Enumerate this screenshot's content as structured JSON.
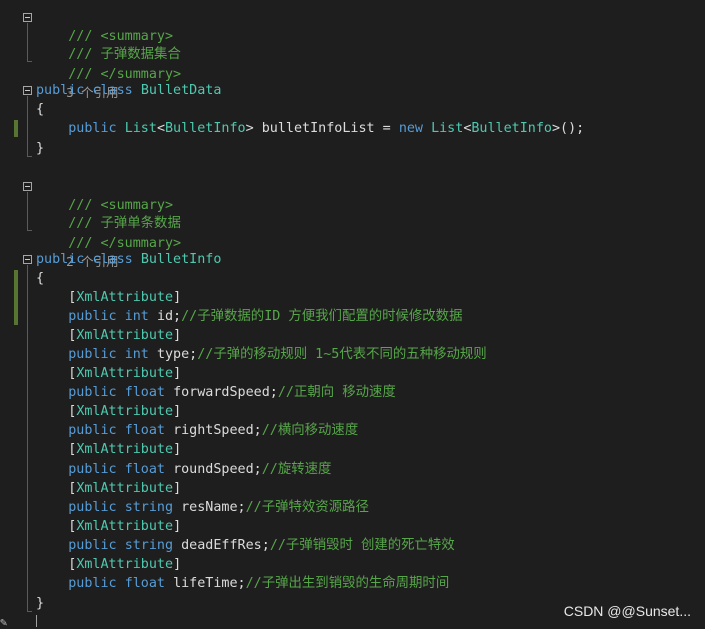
{
  "editor": {
    "block1": {
      "doc_open": "/// <summary>",
      "doc_text": "/// 子弹数据集合",
      "doc_close": "/// </summary>",
      "references": "3 个引用",
      "decl_kw1": "public",
      "decl_kw2": "class",
      "decl_name": "BulletData",
      "open_brace": "{",
      "field": {
        "kw": "public",
        "type1": "List",
        "lt": "<",
        "type2": "BulletInfo",
        "gt_name": "> bulletInfoList = ",
        "new_kw": "new",
        "sp": " ",
        "type3": "List",
        "lt2": "<",
        "type4": "BulletInfo",
        "end": ">();"
      },
      "close_brace": "}"
    },
    "block2": {
      "doc_open": "/// <summary>",
      "doc_text": "/// 子弹单条数据",
      "doc_close": "/// </summary>",
      "references": "2 个引用",
      "decl_kw1": "public",
      "decl_kw2": "class",
      "decl_name": "BulletInfo",
      "open_brace": "{",
      "close_brace": "}",
      "members": [
        {
          "attr_open": "[",
          "attr": "XmlAttribute",
          "attr_close": "]",
          "kw": "public",
          "type": "int",
          "name": "id;",
          "comment": "//子弹数据的ID 方便我们配置的时候修改数据"
        },
        {
          "attr_open": "[",
          "attr": "XmlAttribute",
          "attr_close": "]",
          "kw": "public",
          "type": "int",
          "name": "type;",
          "comment": "//子弹的移动规则 1~5代表不同的五种移动规则"
        },
        {
          "attr_open": "[",
          "attr": "XmlAttribute",
          "attr_close": "]",
          "kw": "public",
          "type": "float",
          "name": "forwardSpeed;",
          "comment": "//正朝向 移动速度"
        },
        {
          "attr_open": "[",
          "attr": "XmlAttribute",
          "attr_close": "]",
          "kw": "public",
          "type": "float",
          "name": "rightSpeed;",
          "comment": "//横向移动速度"
        },
        {
          "attr_open": "[",
          "attr": "XmlAttribute",
          "attr_close": "]",
          "kw": "public",
          "type": "float",
          "name": "roundSpeed;",
          "comment": "//旋转速度"
        },
        {
          "attr_open": "[",
          "attr": "XmlAttribute",
          "attr_close": "]",
          "kw": "public",
          "type": "string",
          "name": "resName;",
          "comment": "//子弹特效资源路径"
        },
        {
          "attr_open": "[",
          "attr": "XmlAttribute",
          "attr_close": "]",
          "kw": "public",
          "type": "string",
          "name": "deadEffRes;",
          "comment": "//子弹销毁时 创建的死亡特效"
        },
        {
          "attr_open": "[",
          "attr": "XmlAttribute",
          "attr_close": "]",
          "kw": "public",
          "type": "float",
          "name": "lifeTime;",
          "comment": "//子弹出生到销毁的生命周期时间"
        }
      ]
    }
  },
  "watermark": "CSDN @@Sunset...",
  "colors": {
    "background": "#1e1e1e",
    "keyword": "#569cd6",
    "type": "#4ec9b0",
    "comment": "#57a64a",
    "plain": "#dcdcdc",
    "change_bar": "#577430"
  }
}
